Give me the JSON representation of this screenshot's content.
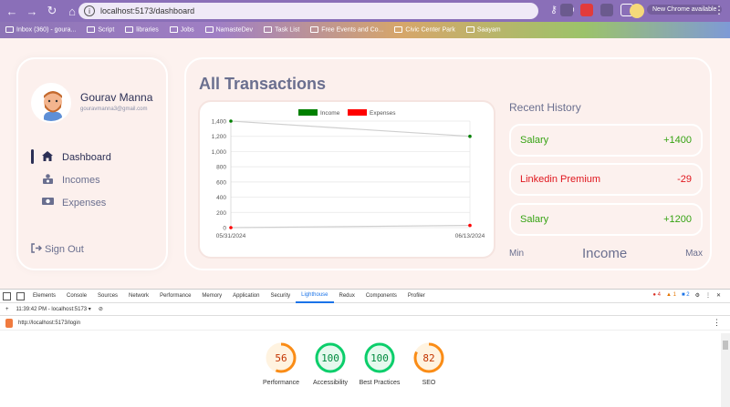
{
  "browser": {
    "url": "localhost:5173/dashboard",
    "new_chrome_label": "New Chrome available",
    "bookmarks": [
      "Inbox (360) - goura...",
      "Script",
      "libraries",
      "Jobs",
      "NamasteDev",
      "Task List",
      "Free Events and Co...",
      "Civic Center Park",
      "Saayam"
    ]
  },
  "sidebar": {
    "user_name": "Gourav Manna",
    "user_email": "gouravmanna3@gmail.com",
    "items": [
      {
        "label": "Dashboard",
        "icon": "home-icon",
        "active": true
      },
      {
        "label": "Incomes",
        "icon": "money-icon",
        "active": false
      },
      {
        "label": "Expenses",
        "icon": "money-bill-icon",
        "active": false
      }
    ],
    "signout_label": "Sign Out"
  },
  "main": {
    "title": "All Transactions",
    "recent_title": "Recent History",
    "history": [
      {
        "label": "Salary",
        "amount": "+1400",
        "color": "#36a313"
      },
      {
        "label": "Linkedin Premium",
        "amount": "-29",
        "color": "#e0161d"
      },
      {
        "label": "Salary",
        "amount": "+1200",
        "color": "#36a313"
      }
    ],
    "minmax": {
      "min": "Min",
      "label": "Income",
      "max": "Max"
    }
  },
  "chart_data": {
    "type": "line",
    "categories": [
      "05/31/2024",
      "06/13/2024"
    ],
    "series": [
      {
        "name": "Income",
        "values": [
          1400,
          1200
        ],
        "color": "#008000"
      },
      {
        "name": "Expenses",
        "values": [
          0,
          29
        ],
        "color": "#ff0000"
      }
    ],
    "yticks": [
      0,
      200,
      400,
      600,
      800,
      "1,000",
      "1,200",
      "1,400"
    ],
    "ylim": [
      0,
      1400
    ],
    "grid": true,
    "legend": "top-center"
  },
  "devtools": {
    "tabs": [
      "Elements",
      "Console",
      "Sources",
      "Network",
      "Performance",
      "Memory",
      "Application",
      "Security",
      "Lighthouse",
      "Redux",
      "Components",
      "Profiler"
    ],
    "active_tab": "Lighthouse",
    "errors": "4",
    "warnings": "1",
    "messages": "2",
    "report_label": "11:39:42 PM - localhost:5173",
    "report_url": "http://localhost:5173/login",
    "scores": [
      {
        "value": 56,
        "label": "Performance",
        "color": "#fa8c16",
        "bg": "#fff3e0"
      },
      {
        "value": 100,
        "label": "Accessibility",
        "color": "#0cce6b",
        "bg": "#e6f9ee"
      },
      {
        "value": 100,
        "label": "Best Practices",
        "color": "#0cce6b",
        "bg": "#e6f9ee"
      },
      {
        "value": 82,
        "label": "SEO",
        "color": "#fa8c16",
        "bg": "#fff3e0"
      }
    ]
  }
}
